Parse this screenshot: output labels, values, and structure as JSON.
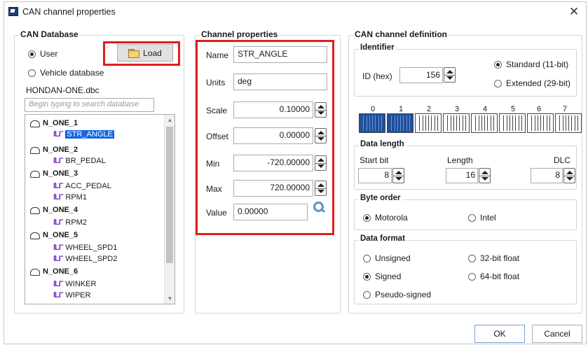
{
  "window": {
    "title": "CAN channel properties"
  },
  "can_database": {
    "title": "CAN Database",
    "source_options": [
      {
        "label": "User",
        "selected": true
      },
      {
        "label": "Vehicle database",
        "selected": false
      }
    ],
    "load_label": "Load",
    "file_name": "HONDAN-ONE.dbc",
    "search_placeholder": "Begin typing to search database",
    "tree": [
      {
        "node": "N_ONE_1",
        "signals": [
          "STR_ANGLE"
        ]
      },
      {
        "node": "N_ONE_2",
        "signals": [
          "BR_PEDAL"
        ]
      },
      {
        "node": "N_ONE_3",
        "signals": [
          "ACC_PEDAL",
          "RPM1"
        ]
      },
      {
        "node": "N_ONE_4",
        "signals": [
          "RPM2"
        ]
      },
      {
        "node": "N_ONE_5",
        "signals": [
          "WHEEL_SPD1",
          "WHEEL_SPD2"
        ]
      },
      {
        "node": "N_ONE_6",
        "signals": [
          "WINKER",
          "WIPER"
        ]
      }
    ],
    "selected_signal": "STR_ANGLE"
  },
  "channel_properties": {
    "title": "Channel properties",
    "name_label": "Name",
    "name_value": "STR_ANGLE",
    "units_label": "Units",
    "units_value": "deg",
    "scale_label": "Scale",
    "scale_value": "0.10000",
    "offset_label": "Offset",
    "offset_value": "0.00000",
    "min_label": "Min",
    "min_value": "-720.00000",
    "max_label": "Max",
    "max_value": "720.00000",
    "value_label": "Value",
    "value_value": "0.00000"
  },
  "can_channel_definition": {
    "title": "CAN channel definition",
    "identifier": {
      "title": "Identifier",
      "id_label": "ID (hex)",
      "id_value": "156",
      "standard_label": "Standard (11-bit)",
      "standard_selected": true,
      "extended_label": "Extended (29-bit)",
      "extended_selected": false
    },
    "byte_labels": [
      "0",
      "1",
      "2",
      "3",
      "4",
      "5",
      "6",
      "7"
    ],
    "highlighted_bytes": [
      0,
      1
    ],
    "data_length": {
      "title": "Data length",
      "start_bit_label": "Start bit",
      "start_bit_value": "8",
      "length_label": "Length",
      "length_value": "16",
      "dlc_label": "DLC",
      "dlc_value": "8"
    },
    "byte_order": {
      "title": "Byte order",
      "motorola_label": "Motorola",
      "motorola_selected": true,
      "intel_label": "Intel",
      "intel_selected": false
    },
    "data_format": {
      "title": "Data format",
      "unsigned_label": "Unsigned",
      "unsigned_selected": false,
      "signed_label": "Signed",
      "signed_selected": true,
      "pseudo_label": "Pseudo-signed",
      "pseudo_selected": false,
      "float32_label": "32-bit float",
      "float32_selected": false,
      "float64_label": "64-bit float",
      "float64_selected": false
    }
  },
  "buttons": {
    "ok_label": "OK",
    "cancel_label": "Cancel"
  },
  "colors": {
    "highlight_red": "#e11d1d",
    "selection_blue": "#1565e0",
    "byte_fill": "#1f4f9e",
    "signal_icon": "#7a2fb8"
  }
}
